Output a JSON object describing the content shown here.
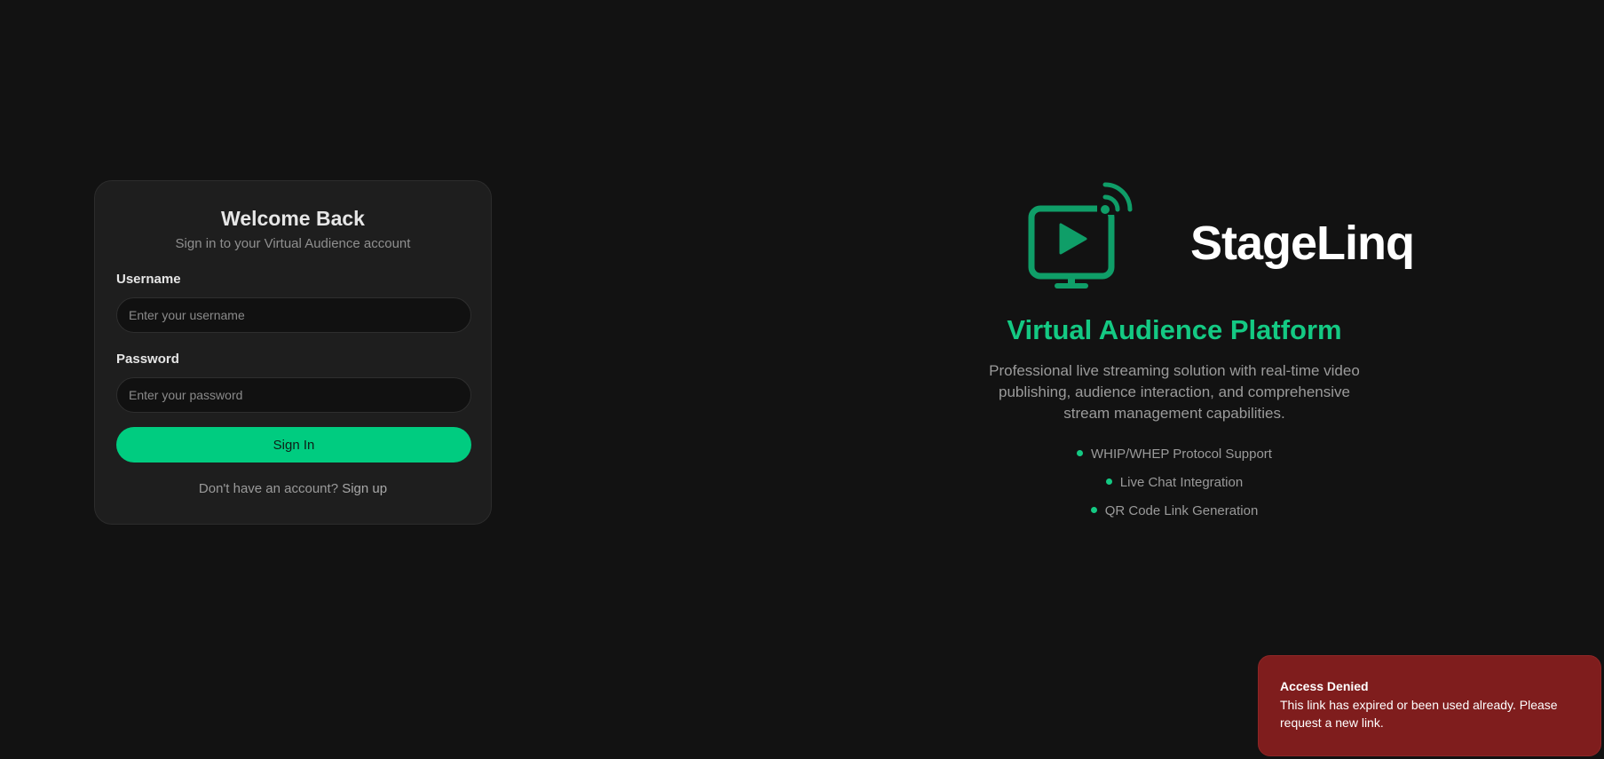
{
  "login": {
    "title": "Welcome Back",
    "subtitle": "Sign in to your Virtual Audience account",
    "username_label": "Username",
    "username_placeholder": "Enter your username",
    "username_value": "",
    "password_label": "Password",
    "password_placeholder": "Enter your password",
    "password_value": "",
    "submit_label": "Sign In",
    "signup_prompt": "Don't have an account?",
    "signup_link": "Sign up"
  },
  "hero": {
    "logo_text": "StageLinq",
    "logo_icon": "monitor-play-broadcast-icon",
    "title": "Virtual Audience Platform",
    "description": "Professional live streaming solution with real-time video publishing, audience interaction, and comprehensive stream management capabilities.",
    "features": [
      "WHIP/WHEP Protocol Support",
      "Live Chat Integration",
      "QR Code Link Generation"
    ]
  },
  "toast": {
    "title": "Access Denied",
    "message": "This link has expired or been used already. Please request a new link."
  },
  "colors": {
    "background": "#121212",
    "card": "#1e1e1e",
    "accent": "#00cc80",
    "brand_green": "#14c983",
    "logo_green": "#0f9e68",
    "toast_error": "#7f1d1d"
  }
}
